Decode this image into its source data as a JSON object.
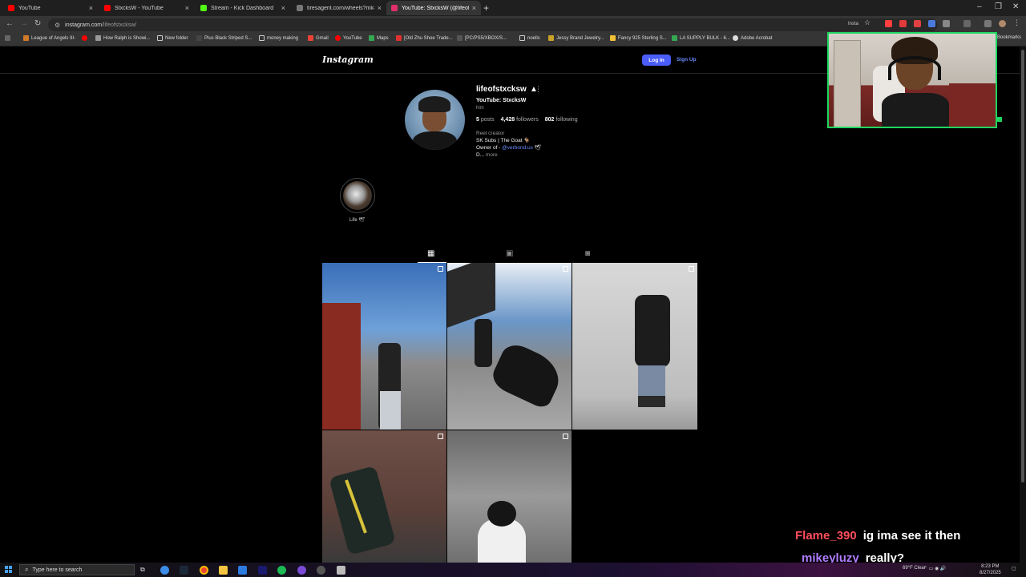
{
  "browser": {
    "tabs": [
      {
        "title": "YouTube",
        "icon": "youtube-icon",
        "color": "#ff0000"
      },
      {
        "title": "StxcksW - YouTube",
        "icon": "youtube-icon",
        "color": "#ff0000"
      },
      {
        "title": "Stream - Kick Dashboard",
        "icon": "kick-icon",
        "color": "#53fc18"
      },
      {
        "title": "tiresagent.com/wheels?mk=1",
        "icon": "site-icon",
        "color": "#777777"
      },
      {
        "title": "YouTube: StxcksW (@lifeofstx",
        "icon": "instagram-icon",
        "color": "#e1306c"
      }
    ],
    "url": "instagram.com",
    "url_path": "/lifeofstxcksw/",
    "bookmarks": [
      "League of Angels III-",
      "",
      "How Ralph is Showi...",
      "New folder",
      "Plus Black Striped S...",
      "money making",
      "Gmail",
      "YouTube",
      "Maps",
      "[Old Zhu Shoe Trade...",
      "[PC/PS5/XBOX/S...",
      "noells",
      "Jessy Brand Jewelry...",
      "Fancy 925 Sterling S...",
      "LA SUPPLY BULK - 6...",
      "Adobe Acrobat"
    ],
    "bookmarks_all": "Bookmarks",
    "extension_label": "Insta"
  },
  "instagram": {
    "logo": "Instagram",
    "login_label": "Log In",
    "signup_label": "Sign Up",
    "username": "lifeofstxcksw",
    "username_more": "⋮",
    "full_name": "YouTube: StxcksW",
    "pronouns": "him",
    "stats": {
      "posts_count": "5",
      "posts_label": "posts",
      "followers_count": "4,428",
      "followers_label": "followers",
      "following_count": "802",
      "following_label": "following"
    },
    "bio": {
      "category": "Reel creator",
      "line1": "SK Subs | The Goat 🐐",
      "line2_prefix": "Owner of - ",
      "line2_link": "@verbond.us",
      "line2_suffix": " 🕊",
      "line3_prefix": "D... ",
      "line3_more": "more"
    },
    "highlight_label": "Life 🕊",
    "tabs": [
      "posts-grid-icon",
      "reels-icon",
      "tagged-icon"
    ],
    "posts": [
      {
        "alt": "post-1",
        "tone": "#7b8aa3"
      },
      {
        "alt": "post-2",
        "tone": "#8fa4bb"
      },
      {
        "alt": "post-3",
        "tone": "#cfcfcf"
      },
      {
        "alt": "post-4",
        "tone": "#7a7a7a"
      },
      {
        "alt": "post-5",
        "tone": "#8a8a8a"
      }
    ]
  },
  "chat": [
    {
      "user": "Flame_390",
      "message": "ig ima see it then",
      "color": "#ff4d5a"
    },
    {
      "user": "mikeyluzy",
      "message": "really?",
      "color": "#b07cff"
    }
  ],
  "taskbar": {
    "search_placeholder": "Type here to search",
    "weather": "69°F  Clear",
    "time": "8:23 PM",
    "date": "8/27/2025"
  }
}
